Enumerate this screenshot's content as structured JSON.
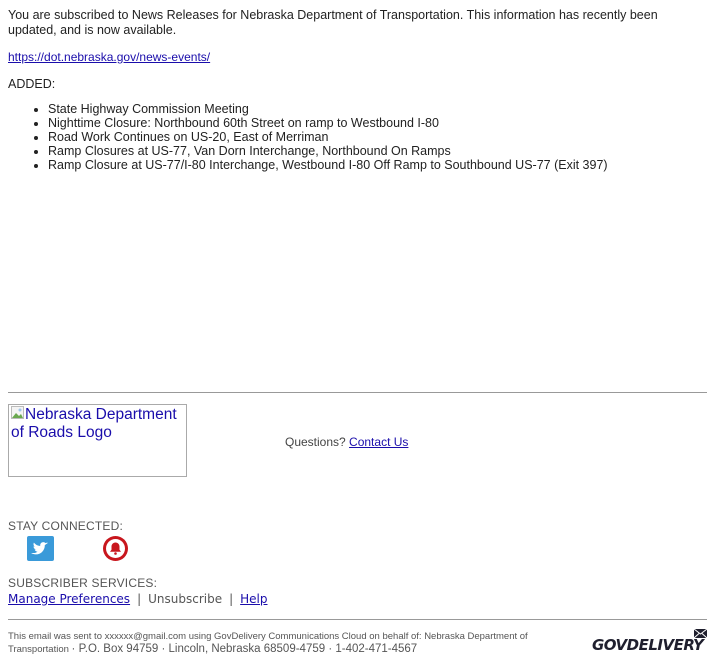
{
  "intro": {
    "text": "You are subscribed to News Releases for Nebraska Department of Transportation. This information has recently been updated, and is now available."
  },
  "url": "https://dot.nebraska.gov/news-events/",
  "added_label": "ADDED:",
  "items": [
    "State Highway Commission Meeting",
    "Nighttime Closure: Northbound 60th Street on ramp to Westbound I-80",
    "Road Work Continues on US-20, East of Merriman",
    "Ramp Closures at US-77, Van Dorn Interchange, Northbound On Ramps",
    "Ramp Closure at US-77/I-80 Interchange, Westbound I-80 Off Ramp to Southbound US-77 (Exit 397)"
  ],
  "logo": {
    "alt": "Nebraska Department of Roads Logo"
  },
  "questions": {
    "label": "Questions?",
    "contact_link": "Contact Us"
  },
  "stay_connected": {
    "label": "STAY CONNECTED:",
    "icons": [
      "twitter-icon",
      "bell-icon"
    ]
  },
  "subscriber_services": {
    "label": "SUBSCRIBER SERVICES:",
    "manage": "Manage Preferences",
    "unsubscribe": "Unsubscribe",
    "help": "Help",
    "separator": "|"
  },
  "footer": {
    "line1": "This email was sent to xxxxxx@gmail.com using GovDelivery Communications Cloud on behalf of: Nebraska Department of Transportation",
    "address": "· P.O. Box 94759 · Lincoln, Nebraska 68509-4759 · 1-402-471-4567",
    "brand": "GOVDELIVERY"
  },
  "colors": {
    "link": "#1a0dab",
    "twitter": "#3a9ad9",
    "bell": "#c8161d"
  }
}
